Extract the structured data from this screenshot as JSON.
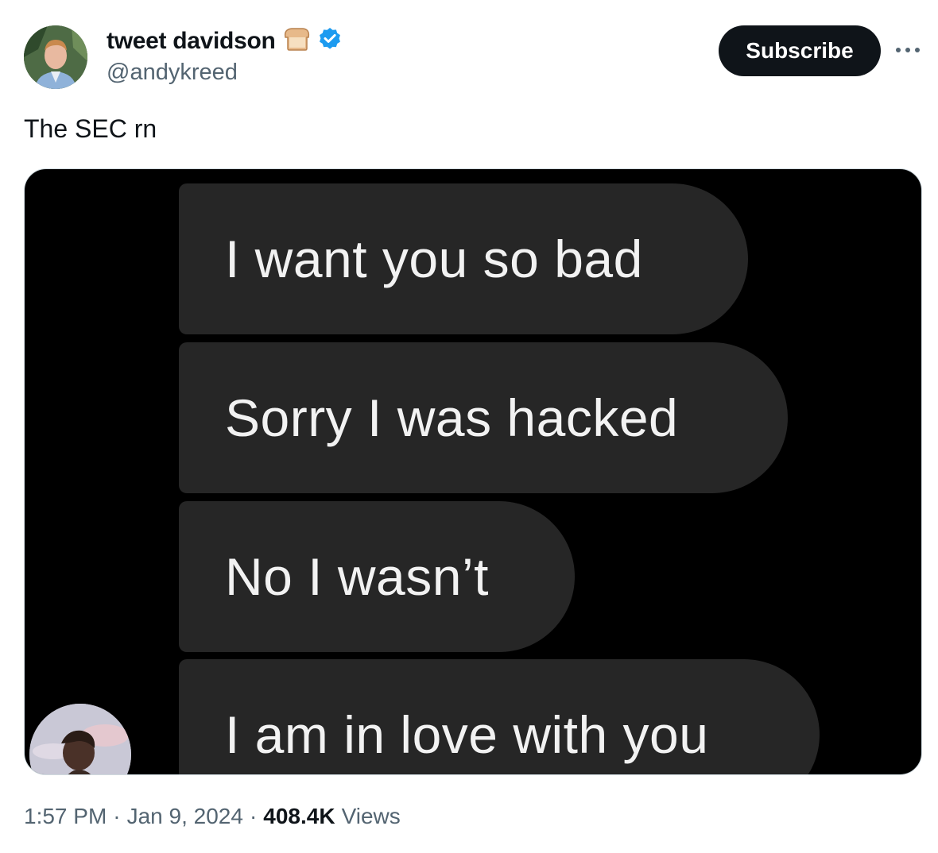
{
  "author": {
    "display_name": "tweet davidson",
    "handle": "@andykreed",
    "emoji_icon": "bread-icon",
    "verified_icon": "verified-badge-icon",
    "verified_color": "#1d9bf0"
  },
  "header": {
    "subscribe_label": "Subscribe",
    "more_icon": "more-options-icon"
  },
  "tweet": {
    "text": "The SEC rn"
  },
  "media": {
    "messages": [
      "I want you so bad",
      "Sorry I was hacked",
      "No I wasn’t",
      "I am in love with you"
    ],
    "bubble_color": "#262626",
    "background_color": "#000000"
  },
  "meta": {
    "time": "1:57 PM",
    "sep1": "·",
    "date": "Jan 9, 2024",
    "sep2": "·",
    "views_count": "408.4K",
    "views_label": "Views"
  }
}
